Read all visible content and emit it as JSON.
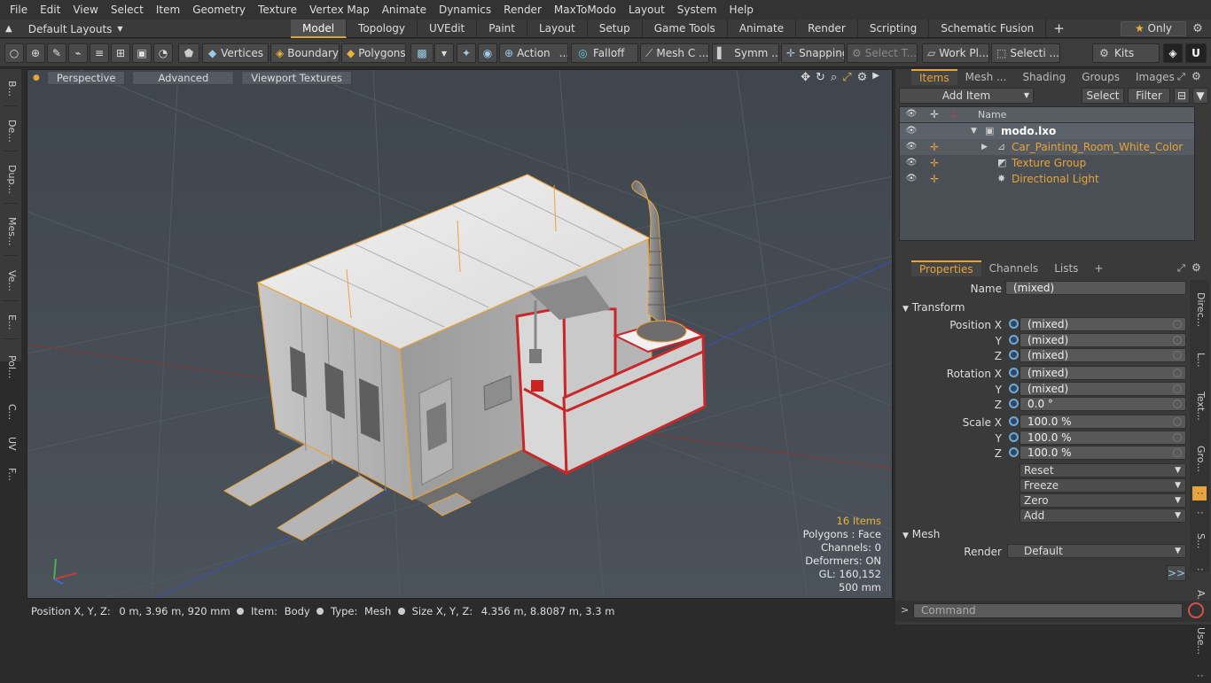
{
  "menu": [
    "File",
    "Edit",
    "View",
    "Select",
    "Item",
    "Geometry",
    "Texture",
    "Vertex Map",
    "Animate",
    "Dynamics",
    "Render",
    "MaxToModo",
    "Layout",
    "System",
    "Help"
  ],
  "layout_selector": "Default Layouts",
  "tabs": [
    "Model",
    "Topology",
    "UVEdit",
    "Paint",
    "Layout",
    "Setup",
    "Game Tools",
    "Animate",
    "Render",
    "Scripting",
    "Schematic Fusion"
  ],
  "tab_plus": "+",
  "only_label": "Only",
  "toolbar": {
    "vertices": "Vertices",
    "boundary": "Boundary",
    "polygons": "Polygons",
    "action": "Action",
    "action_more": "...",
    "falloff": "Falloff",
    "mesh_c": "Mesh C ...",
    "symm": "Symm ...",
    "snapping": "Snapping",
    "select_t": "Select T...",
    "work_pl": "Work Pl...",
    "selecti": "Selecti ...",
    "kits": "Kits"
  },
  "left_tabs": [
    "B...",
    "De...",
    "Dup...",
    "Mes...",
    "Ve...",
    "E...",
    "Pol...",
    "C...",
    "UV",
    "F..."
  ],
  "viewport": {
    "perspective": "Perspective",
    "advanced": "Advanced",
    "viewport_textures": "Viewport Textures",
    "info": {
      "items": "16 Items",
      "polygons": "Polygons : Face",
      "channels": "Channels: 0",
      "deformers": "Deformers: ON",
      "gl": "GL: 160,152",
      "scale": "500 mm"
    }
  },
  "status": {
    "position_label": "Position X, Y, Z:",
    "position_value": "0 m, 3.96 m, 920 mm",
    "item_label": "Item:",
    "item_value": "Body",
    "type_label": "Type:",
    "type_value": "Mesh",
    "size_label": "Size X, Y, Z:",
    "size_value": "4.356 m, 8.8087 m, 3.3 m"
  },
  "items_panel": {
    "tabs": [
      "Items",
      "Mesh ...",
      "Shading",
      "Groups",
      "Images"
    ],
    "add_item": "Add Item",
    "select": "Select",
    "filter": "Filter",
    "col_name": "Name",
    "rows": [
      {
        "name": "modo.lxo"
      },
      {
        "name": "Car_Painting_Room_White_Color"
      },
      {
        "name": "Texture Group"
      },
      {
        "name": "Directional Light"
      }
    ]
  },
  "properties": {
    "tabs": [
      "Properties",
      "Channels",
      "Lists"
    ],
    "tab_plus": "+",
    "name_label": "Name",
    "name_value": "(mixed)",
    "transform_label": "Transform",
    "position_x_label": "Position X",
    "rotation_x_label": "Rotation X",
    "scale_x_label": "Scale X",
    "y": "Y",
    "z": "Z",
    "position": [
      "(mixed)",
      "(mixed)",
      "(mixed)"
    ],
    "rotation": [
      "(mixed)",
      "(mixed)",
      "0.0 °"
    ],
    "scale": [
      "100.0 %",
      "100.0 %",
      "100.0 %"
    ],
    "reset": "Reset",
    "freeze": "Freeze",
    "zero": "Zero",
    "add": "Add",
    "mesh_label": "Mesh",
    "render_label": "Render",
    "render_value": "Default",
    "more": ">>"
  },
  "right_vtabs": [
    "Direc...",
    "L...",
    "Text...",
    "Gro...",
    ":",
    ":",
    "S...",
    ":",
    "A...",
    "Use...",
    ":"
  ],
  "command_placeholder": "Command",
  "colors": {
    "accent": "#e8a33a",
    "viewport_bg": "#444b54",
    "selection": "#e8a33a",
    "red_frame": "#c8282a"
  }
}
